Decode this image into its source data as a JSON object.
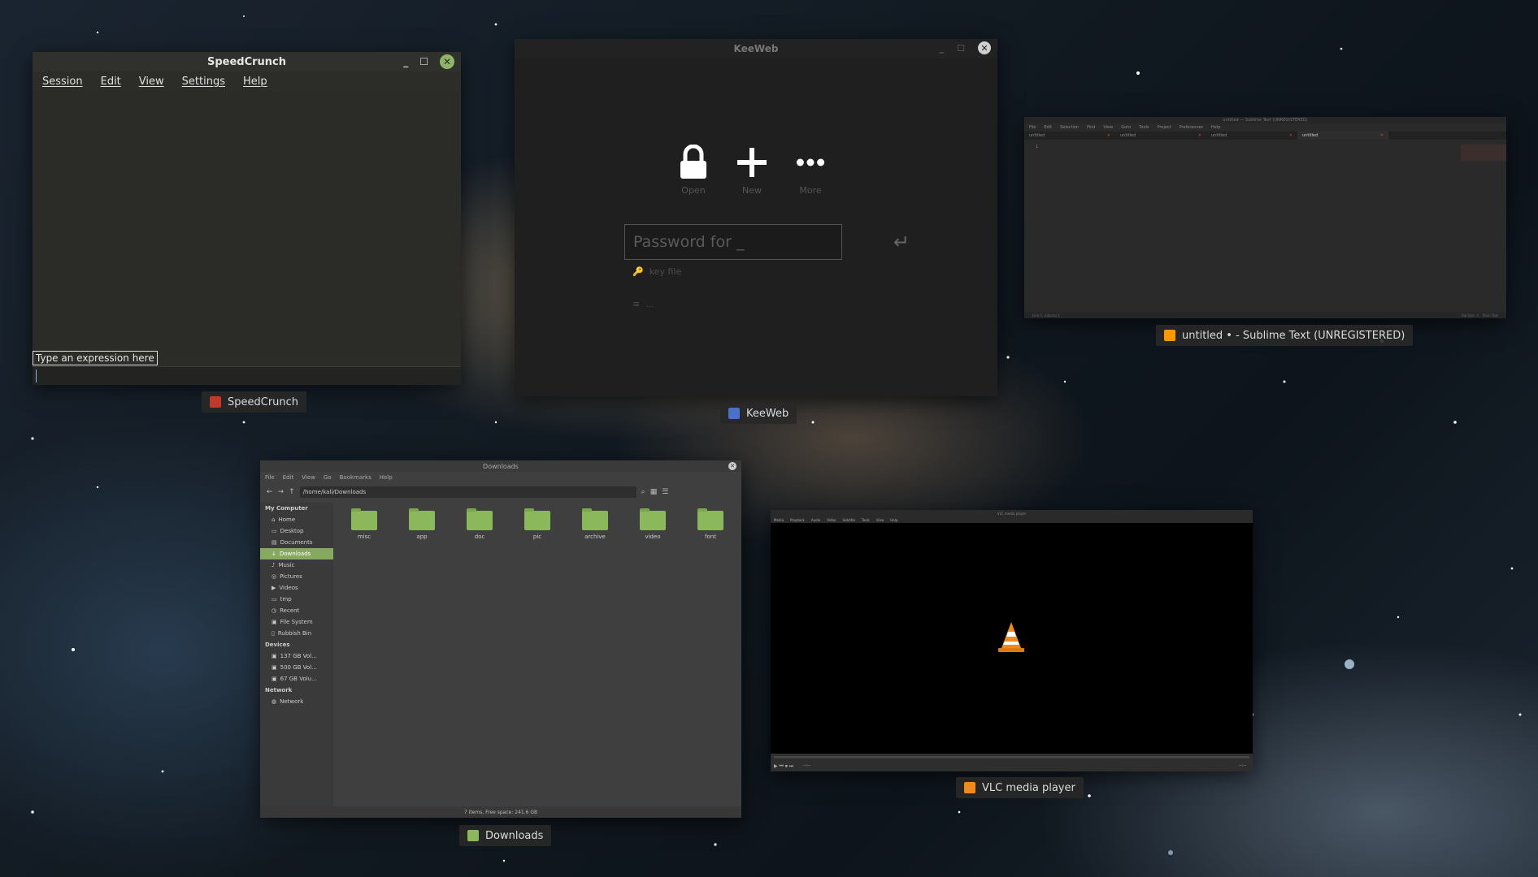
{
  "speedcrunch": {
    "title": "SpeedCrunch",
    "menu": [
      "Session",
      "Edit",
      "View",
      "Settings",
      "Help"
    ],
    "hint": "Type an expression here",
    "label": "SpeedCrunch"
  },
  "keeweb": {
    "title": "KeeWeb",
    "open": "Open",
    "new": "New",
    "more": "More",
    "password_placeholder": "Password for _",
    "key_file": "key file",
    "more_dots": "...",
    "label": "KeeWeb"
  },
  "sublime": {
    "title": "untitled — Sublime Text (UNREGISTERED)",
    "menu": [
      "File",
      "Edit",
      "Selection",
      "Find",
      "View",
      "Goto",
      "Tools",
      "Project",
      "Preferences",
      "Help"
    ],
    "tabs": [
      "untitled",
      "untitled",
      "untitled",
      "untitled"
    ],
    "line": "1",
    "status_left": "Line 1, Column 1",
    "status_right": "Tab Size: 4",
    "status_syntax": "Plain Text",
    "label": "untitled • - Sublime Text (UNREGISTERED)"
  },
  "downloads": {
    "title": "Downloads",
    "menu": [
      "File",
      "Edit",
      "View",
      "Go",
      "Bookmarks",
      "Help"
    ],
    "path": "/home/kali/Downloads",
    "sections": {
      "my_computer": "My Computer",
      "devices": "Devices",
      "network": "Network"
    },
    "places": [
      "Home",
      "Desktop",
      "Documents",
      "Downloads",
      "Music",
      "Pictures",
      "Videos",
      "tmp",
      "Recent",
      "File System",
      "Rubbish Bin"
    ],
    "devices": [
      "137 GB Vol...",
      "500 GB Vol...",
      "67 GB Volu..."
    ],
    "network_items": [
      "Network"
    ],
    "folders": [
      "misc",
      "app",
      "doc",
      "pic",
      "archive",
      "video",
      "font"
    ],
    "status": "7 items, Free space: 241.6 GB",
    "label": "Downloads"
  },
  "vlc": {
    "title": "VLC media player",
    "menu": [
      "Media",
      "Playback",
      "Audio",
      "Video",
      "Subtitle",
      "Tools",
      "View",
      "Help"
    ],
    "time_left": "--:--",
    "time_right": "--:--",
    "label": "VLC media player"
  },
  "colors": {
    "accent_green": "#8cb85c",
    "vlc_orange": "#f08a1c"
  }
}
